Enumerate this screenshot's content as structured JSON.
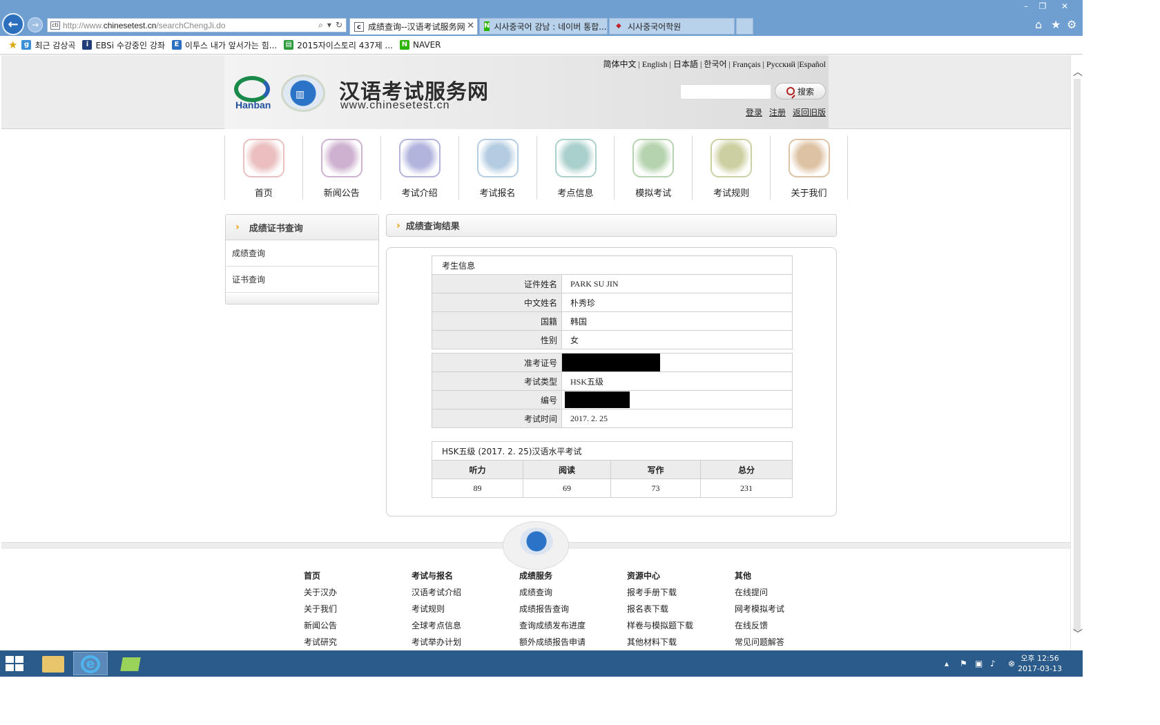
{
  "browser": {
    "url_prefix": "http://www.",
    "url_domain": "chinesetest.cn",
    "url_path": "/searchChengJi.do",
    "tabs": [
      {
        "label": "成绩查询--汉语考试服务网",
        "icon": "cti"
      },
      {
        "label": "시사중국어 강남 : 네이버 통합...",
        "icon": "N"
      },
      {
        "label": "시사중국어학원",
        "icon": "shield"
      }
    ]
  },
  "favorites": [
    {
      "label": "최근 감상곡",
      "icon": "g"
    },
    {
      "label": "EBSi  수강중인 강좌",
      "icon": "i"
    },
    {
      "label": "이투스  내가 앞서가는 힘...",
      "icon": "E"
    },
    {
      "label": "2015자이스토리 437제 ...",
      "icon": "doc"
    },
    {
      "label": "NAVER",
      "icon": "N"
    }
  ],
  "header": {
    "site_title": "汉语考试服务网",
    "site_url": "www.chinesetest.cn",
    "logo_text": "Hanban",
    "languages": "简体中文 | English | 日本語 | 한국어 | Français | Русский |Español",
    "search_button": "搜索",
    "user_links": [
      "登录",
      "注册",
      "返回旧版"
    ]
  },
  "nav": [
    {
      "label": "首页",
      "color": "#e8b4b4"
    },
    {
      "label": "新闻公告",
      "color": "#c6a4c8"
    },
    {
      "label": "考试介绍",
      "color": "#a6a8d8"
    },
    {
      "label": "考试报名",
      "color": "#a8c4dc"
    },
    {
      "label": "考点信息",
      "color": "#9cc8c4"
    },
    {
      "label": "模拟考试",
      "color": "#a8cca0"
    },
    {
      "label": "考试规则",
      "color": "#c4c890"
    },
    {
      "label": "关于我们",
      "color": "#d8b894"
    }
  ],
  "sidebar": {
    "title": "成绩证书查询",
    "items": [
      "成绩查询",
      "证书查询"
    ]
  },
  "content": {
    "title": "成绩查询结果",
    "info_caption": "考生信息",
    "info": [
      {
        "label": "证件姓名",
        "value": "PARK SU JIN"
      },
      {
        "label": "中文姓名",
        "value": "朴秀珍"
      },
      {
        "label": "国籍",
        "value": "韩国"
      },
      {
        "label": "性别",
        "value": "女"
      }
    ],
    "exam_info": [
      {
        "label": "准考证号",
        "value": ""
      },
      {
        "label": "考试类型",
        "value": "HSK五级"
      },
      {
        "label": "编号",
        "value": ""
      },
      {
        "label": "考试时间",
        "value": "2017. 2. 25"
      }
    ],
    "score_caption": "HSK五级 (2017. 2. 25)汉语水平考试",
    "score_headers": [
      "听力",
      "阅读",
      "写作",
      "总分"
    ],
    "scores": [
      "89",
      "69",
      "73",
      "231"
    ]
  },
  "footer": {
    "columns": [
      {
        "title": "首页",
        "links": [
          "关于汉办",
          "关于我们",
          "新闻公告",
          "考试研究"
        ]
      },
      {
        "title": "考试与报名",
        "links": [
          "汉语考试介绍",
          "考试规则",
          "全球考点信息",
          "考试举办计划"
        ]
      },
      {
        "title": "成绩服务",
        "links": [
          "成绩查询",
          "成绩报告查询",
          "查询成绩发布进度",
          "额外成绩报告申请"
        ]
      },
      {
        "title": "资源中心",
        "links": [
          "报考手册下载",
          "报名表下载",
          "样卷与模拟题下载",
          "其他材料下载"
        ]
      },
      {
        "title": "其他",
        "links": [
          "在线提问",
          "网考模拟考试",
          "在线反馈",
          "常见问题解答"
        ]
      }
    ]
  },
  "taskbar": {
    "time": "오후 12:56",
    "date": "2017-03-13"
  }
}
